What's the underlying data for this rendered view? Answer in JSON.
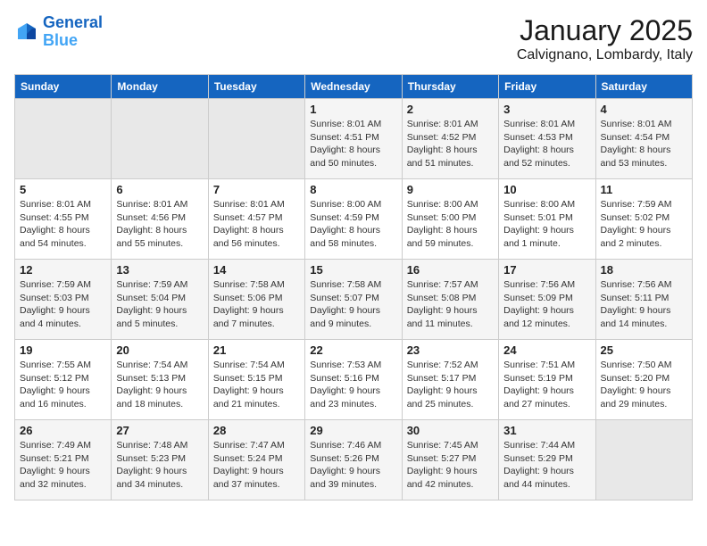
{
  "header": {
    "logo_line1": "General",
    "logo_line2": "Blue",
    "month": "January 2025",
    "location": "Calvignano, Lombardy, Italy"
  },
  "weekdays": [
    "Sunday",
    "Monday",
    "Tuesday",
    "Wednesday",
    "Thursday",
    "Friday",
    "Saturday"
  ],
  "weeks": [
    [
      {
        "day": "",
        "info": ""
      },
      {
        "day": "",
        "info": ""
      },
      {
        "day": "",
        "info": ""
      },
      {
        "day": "1",
        "info": "Sunrise: 8:01 AM\nSunset: 4:51 PM\nDaylight: 8 hours\nand 50 minutes."
      },
      {
        "day": "2",
        "info": "Sunrise: 8:01 AM\nSunset: 4:52 PM\nDaylight: 8 hours\nand 51 minutes."
      },
      {
        "day": "3",
        "info": "Sunrise: 8:01 AM\nSunset: 4:53 PM\nDaylight: 8 hours\nand 52 minutes."
      },
      {
        "day": "4",
        "info": "Sunrise: 8:01 AM\nSunset: 4:54 PM\nDaylight: 8 hours\nand 53 minutes."
      }
    ],
    [
      {
        "day": "5",
        "info": "Sunrise: 8:01 AM\nSunset: 4:55 PM\nDaylight: 8 hours\nand 54 minutes."
      },
      {
        "day": "6",
        "info": "Sunrise: 8:01 AM\nSunset: 4:56 PM\nDaylight: 8 hours\nand 55 minutes."
      },
      {
        "day": "7",
        "info": "Sunrise: 8:01 AM\nSunset: 4:57 PM\nDaylight: 8 hours\nand 56 minutes."
      },
      {
        "day": "8",
        "info": "Sunrise: 8:00 AM\nSunset: 4:59 PM\nDaylight: 8 hours\nand 58 minutes."
      },
      {
        "day": "9",
        "info": "Sunrise: 8:00 AM\nSunset: 5:00 PM\nDaylight: 8 hours\nand 59 minutes."
      },
      {
        "day": "10",
        "info": "Sunrise: 8:00 AM\nSunset: 5:01 PM\nDaylight: 9 hours\nand 1 minute."
      },
      {
        "day": "11",
        "info": "Sunrise: 7:59 AM\nSunset: 5:02 PM\nDaylight: 9 hours\nand 2 minutes."
      }
    ],
    [
      {
        "day": "12",
        "info": "Sunrise: 7:59 AM\nSunset: 5:03 PM\nDaylight: 9 hours\nand 4 minutes."
      },
      {
        "day": "13",
        "info": "Sunrise: 7:59 AM\nSunset: 5:04 PM\nDaylight: 9 hours\nand 5 minutes."
      },
      {
        "day": "14",
        "info": "Sunrise: 7:58 AM\nSunset: 5:06 PM\nDaylight: 9 hours\nand 7 minutes."
      },
      {
        "day": "15",
        "info": "Sunrise: 7:58 AM\nSunset: 5:07 PM\nDaylight: 9 hours\nand 9 minutes."
      },
      {
        "day": "16",
        "info": "Sunrise: 7:57 AM\nSunset: 5:08 PM\nDaylight: 9 hours\nand 11 minutes."
      },
      {
        "day": "17",
        "info": "Sunrise: 7:56 AM\nSunset: 5:09 PM\nDaylight: 9 hours\nand 12 minutes."
      },
      {
        "day": "18",
        "info": "Sunrise: 7:56 AM\nSunset: 5:11 PM\nDaylight: 9 hours\nand 14 minutes."
      }
    ],
    [
      {
        "day": "19",
        "info": "Sunrise: 7:55 AM\nSunset: 5:12 PM\nDaylight: 9 hours\nand 16 minutes."
      },
      {
        "day": "20",
        "info": "Sunrise: 7:54 AM\nSunset: 5:13 PM\nDaylight: 9 hours\nand 18 minutes."
      },
      {
        "day": "21",
        "info": "Sunrise: 7:54 AM\nSunset: 5:15 PM\nDaylight: 9 hours\nand 21 minutes."
      },
      {
        "day": "22",
        "info": "Sunrise: 7:53 AM\nSunset: 5:16 PM\nDaylight: 9 hours\nand 23 minutes."
      },
      {
        "day": "23",
        "info": "Sunrise: 7:52 AM\nSunset: 5:17 PM\nDaylight: 9 hours\nand 25 minutes."
      },
      {
        "day": "24",
        "info": "Sunrise: 7:51 AM\nSunset: 5:19 PM\nDaylight: 9 hours\nand 27 minutes."
      },
      {
        "day": "25",
        "info": "Sunrise: 7:50 AM\nSunset: 5:20 PM\nDaylight: 9 hours\nand 29 minutes."
      }
    ],
    [
      {
        "day": "26",
        "info": "Sunrise: 7:49 AM\nSunset: 5:21 PM\nDaylight: 9 hours\nand 32 minutes."
      },
      {
        "day": "27",
        "info": "Sunrise: 7:48 AM\nSunset: 5:23 PM\nDaylight: 9 hours\nand 34 minutes."
      },
      {
        "day": "28",
        "info": "Sunrise: 7:47 AM\nSunset: 5:24 PM\nDaylight: 9 hours\nand 37 minutes."
      },
      {
        "day": "29",
        "info": "Sunrise: 7:46 AM\nSunset: 5:26 PM\nDaylight: 9 hours\nand 39 minutes."
      },
      {
        "day": "30",
        "info": "Sunrise: 7:45 AM\nSunset: 5:27 PM\nDaylight: 9 hours\nand 42 minutes."
      },
      {
        "day": "31",
        "info": "Sunrise: 7:44 AM\nSunset: 5:29 PM\nDaylight: 9 hours\nand 44 minutes."
      },
      {
        "day": "",
        "info": ""
      }
    ]
  ]
}
